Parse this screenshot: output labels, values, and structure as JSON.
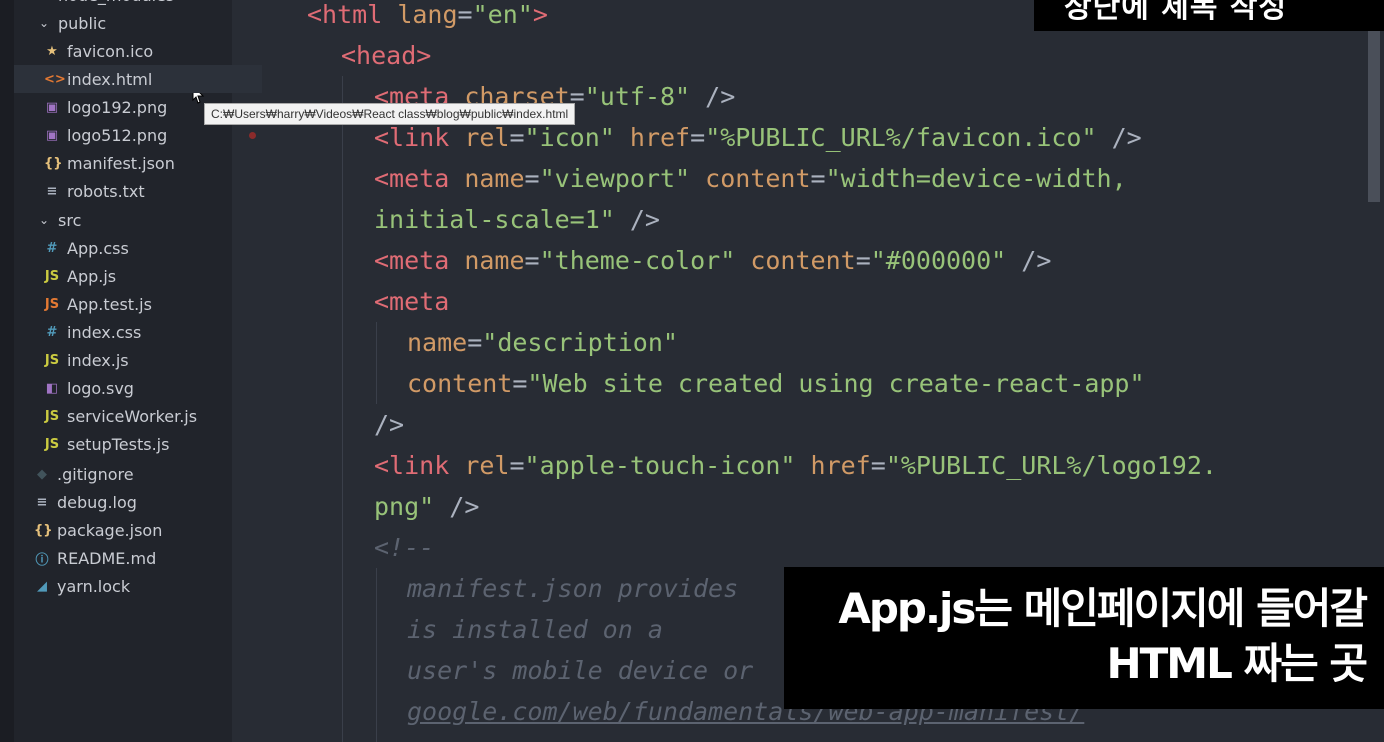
{
  "explorer": {
    "items": [
      {
        "label": "node_modules",
        "icon": "chevron-right-icon"
      },
      {
        "label": "public",
        "icon": "chevron-down-icon"
      },
      {
        "label": "favicon.ico",
        "icon": "star-icon",
        "glyph": "★",
        "color": "#e5c07b"
      },
      {
        "label": "index.html",
        "icon": "html-file-icon",
        "glyph": "<>",
        "color": "#e37933"
      },
      {
        "label": "logo192.png",
        "icon": "image-file-icon",
        "glyph": "▣",
        "color": "#a074c4"
      },
      {
        "label": "logo512.png",
        "icon": "image-file-icon",
        "glyph": "▣",
        "color": "#a074c4"
      },
      {
        "label": "manifest.json",
        "icon": "json-file-icon",
        "glyph": "{}",
        "color": "#e5c07b"
      },
      {
        "label": "robots.txt",
        "icon": "text-file-icon",
        "glyph": "≡",
        "color": "#abb2bf"
      },
      {
        "label": "src",
        "icon": "chevron-down-icon"
      },
      {
        "label": "App.css",
        "icon": "css-file-icon",
        "glyph": "#",
        "color": "#519aba"
      },
      {
        "label": "App.js",
        "icon": "js-file-icon",
        "glyph": "JS",
        "color": "#cbcb41"
      },
      {
        "label": "App.test.js",
        "icon": "test-js-file-icon",
        "glyph": "JS",
        "color": "#e37933"
      },
      {
        "label": "index.css",
        "icon": "css-file-icon",
        "glyph": "#",
        "color": "#519aba"
      },
      {
        "label": "index.js",
        "icon": "js-file-icon",
        "glyph": "JS",
        "color": "#cbcb41"
      },
      {
        "label": "logo.svg",
        "icon": "svg-file-icon",
        "glyph": "◧",
        "color": "#a074c4"
      },
      {
        "label": "serviceWorker.js",
        "icon": "js-file-icon",
        "glyph": "JS",
        "color": "#cbcb41"
      },
      {
        "label": "setupTests.js",
        "icon": "js-file-icon",
        "glyph": "JS",
        "color": "#cbcb41"
      },
      {
        "label": ".gitignore",
        "icon": "git-icon",
        "glyph": "◆",
        "color": "#41535b"
      },
      {
        "label": "debug.log",
        "icon": "log-file-icon",
        "glyph": "≡",
        "color": "#abb2bf"
      },
      {
        "label": "package.json",
        "icon": "json-file-icon",
        "glyph": "{}",
        "color": "#e5c07b"
      },
      {
        "label": "README.md",
        "icon": "info-icon",
        "glyph": "ⓘ",
        "color": "#519aba"
      },
      {
        "label": "yarn.lock",
        "icon": "yarn-icon",
        "glyph": "◢",
        "color": "#519aba"
      }
    ],
    "tooltip": "C:₩Users₩harry₩Videos₩React class₩blog₩public₩index.html"
  },
  "editor": {
    "lines": [
      [
        [
          "tag",
          "<html "
        ],
        [
          "attr",
          "lang"
        ],
        [
          "pun",
          "="
        ],
        [
          "str",
          "\"en\""
        ],
        [
          "tag",
          ">"
        ]
      ],
      [
        [
          "tag",
          "<head>"
        ]
      ],
      [
        [
          "tag",
          "<meta "
        ],
        [
          "attr",
          "charset"
        ],
        [
          "pun",
          "="
        ],
        [
          "str",
          "\"utf-8\""
        ],
        [
          "pun",
          " />"
        ]
      ],
      [
        [
          "tag",
          "<link "
        ],
        [
          "attr",
          "rel"
        ],
        [
          "pun",
          "="
        ],
        [
          "str",
          "\"icon\""
        ],
        [
          "pun",
          " "
        ],
        [
          "attr",
          "href"
        ],
        [
          "pun",
          "="
        ],
        [
          "str",
          "\"%PUBLIC_URL%/favicon.ico\""
        ],
        [
          "pun",
          " />"
        ]
      ],
      [
        [
          "tag",
          "<meta "
        ],
        [
          "attr",
          "name"
        ],
        [
          "pun",
          "="
        ],
        [
          "str",
          "\"viewport\""
        ],
        [
          "pun",
          " "
        ],
        [
          "attr",
          "content"
        ],
        [
          "pun",
          "="
        ],
        [
          "str",
          "\"width=device-width,"
        ]
      ],
      [
        [
          "str",
          "initial-scale=1\""
        ],
        [
          "pun",
          " />"
        ]
      ],
      [
        [
          "tag",
          "<meta "
        ],
        [
          "attr",
          "name"
        ],
        [
          "pun",
          "="
        ],
        [
          "str",
          "\"theme-color\""
        ],
        [
          "pun",
          " "
        ],
        [
          "attr",
          "content"
        ],
        [
          "pun",
          "="
        ],
        [
          "str",
          "\"#000000\""
        ],
        [
          "pun",
          " />"
        ]
      ],
      [
        [
          "tag",
          "<meta"
        ]
      ],
      [
        [
          "attr",
          "name"
        ],
        [
          "pun",
          "="
        ],
        [
          "str",
          "\"description\""
        ]
      ],
      [
        [
          "attr",
          "content"
        ],
        [
          "pun",
          "="
        ],
        [
          "str",
          "\"Web site created using create-react-app\""
        ]
      ],
      [
        [
          "pun",
          "/>"
        ]
      ],
      [
        [
          "tag",
          "<link "
        ],
        [
          "attr",
          "rel"
        ],
        [
          "pun",
          "="
        ],
        [
          "str",
          "\"apple-touch-icon\""
        ],
        [
          "pun",
          " "
        ],
        [
          "attr",
          "href"
        ],
        [
          "pun",
          "="
        ],
        [
          "str",
          "\"%PUBLIC_URL%/logo192."
        ]
      ],
      [
        [
          "str",
          "png\""
        ],
        [
          "pun",
          " />"
        ]
      ],
      [
        [
          "cmt",
          "<!--"
        ]
      ],
      [
        [
          "cmt",
          "manifest.json provides"
        ]
      ],
      [
        [
          "cmt",
          "is installed on a"
        ]
      ],
      [
        [
          "cmt",
          "user's mobile device or"
        ]
      ],
      [
        [
          "cmt-u",
          "google.com/web/fundamentals/web-app-manifest/"
        ]
      ]
    ]
  },
  "captions": {
    "top": "상단에 제목 작성",
    "bottom_line1": "App.js는 메인페이지에 들어갈",
    "bottom_line2": "HTML 짜는 곳"
  }
}
